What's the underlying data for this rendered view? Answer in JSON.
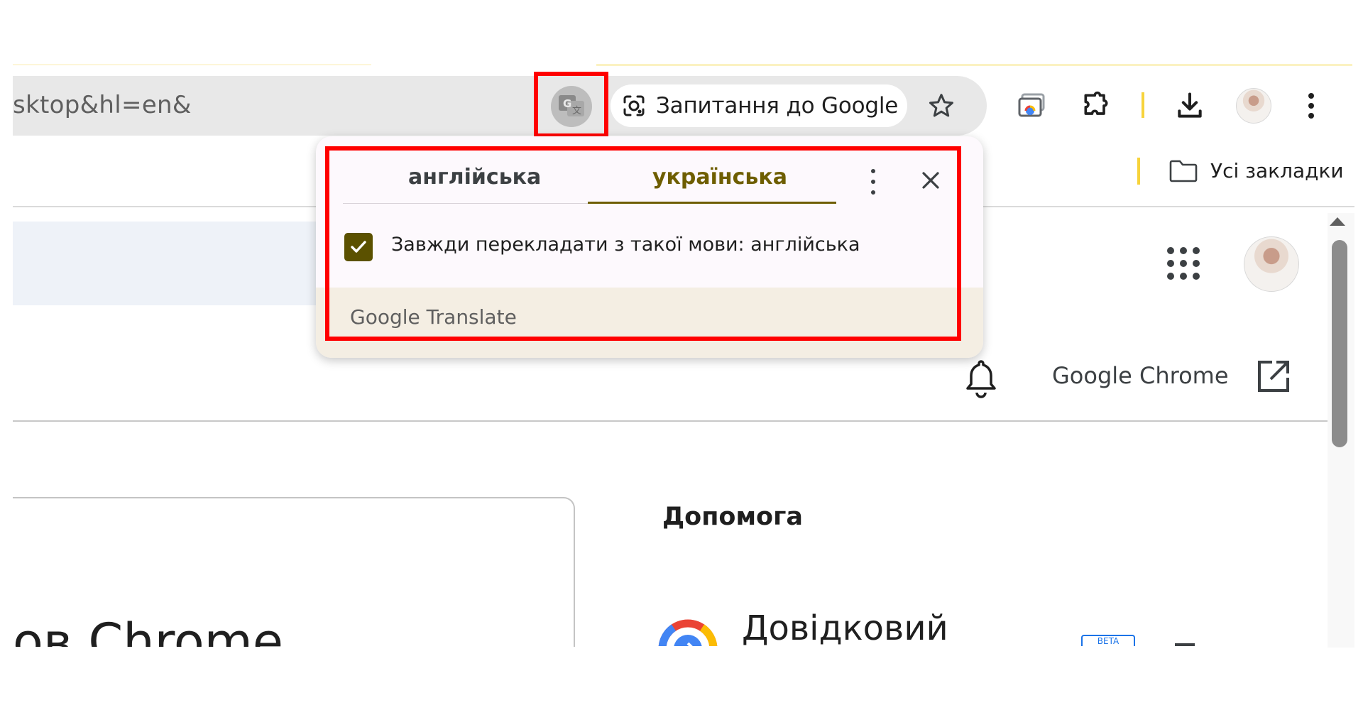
{
  "omnibox": {
    "url_fragment": "sktop&hl=en&",
    "ask_google_label": "Запитання до Google"
  },
  "bookmarks": {
    "all_bookmarks_label": "Усі закладки"
  },
  "translate_popup": {
    "source_language": "англійська",
    "target_language": "українська",
    "always_translate_label": "Завжди перекладати з такої мови: англійська",
    "always_translate_checked": true,
    "footer_brand_google": "Google",
    "footer_brand_translate": "Translate"
  },
  "page": {
    "header_link": "Google Chrome",
    "help_heading": "Допомога",
    "help_center_title": "Довідковий",
    "card_title_partial": "ов Chrome",
    "beta_badge": "BETA"
  },
  "colors": {
    "highlight": "#ff0000",
    "accent_olive": "#6e5e00",
    "checkbox_fill": "#5b5100",
    "popup_footer": "#f4eee3"
  }
}
